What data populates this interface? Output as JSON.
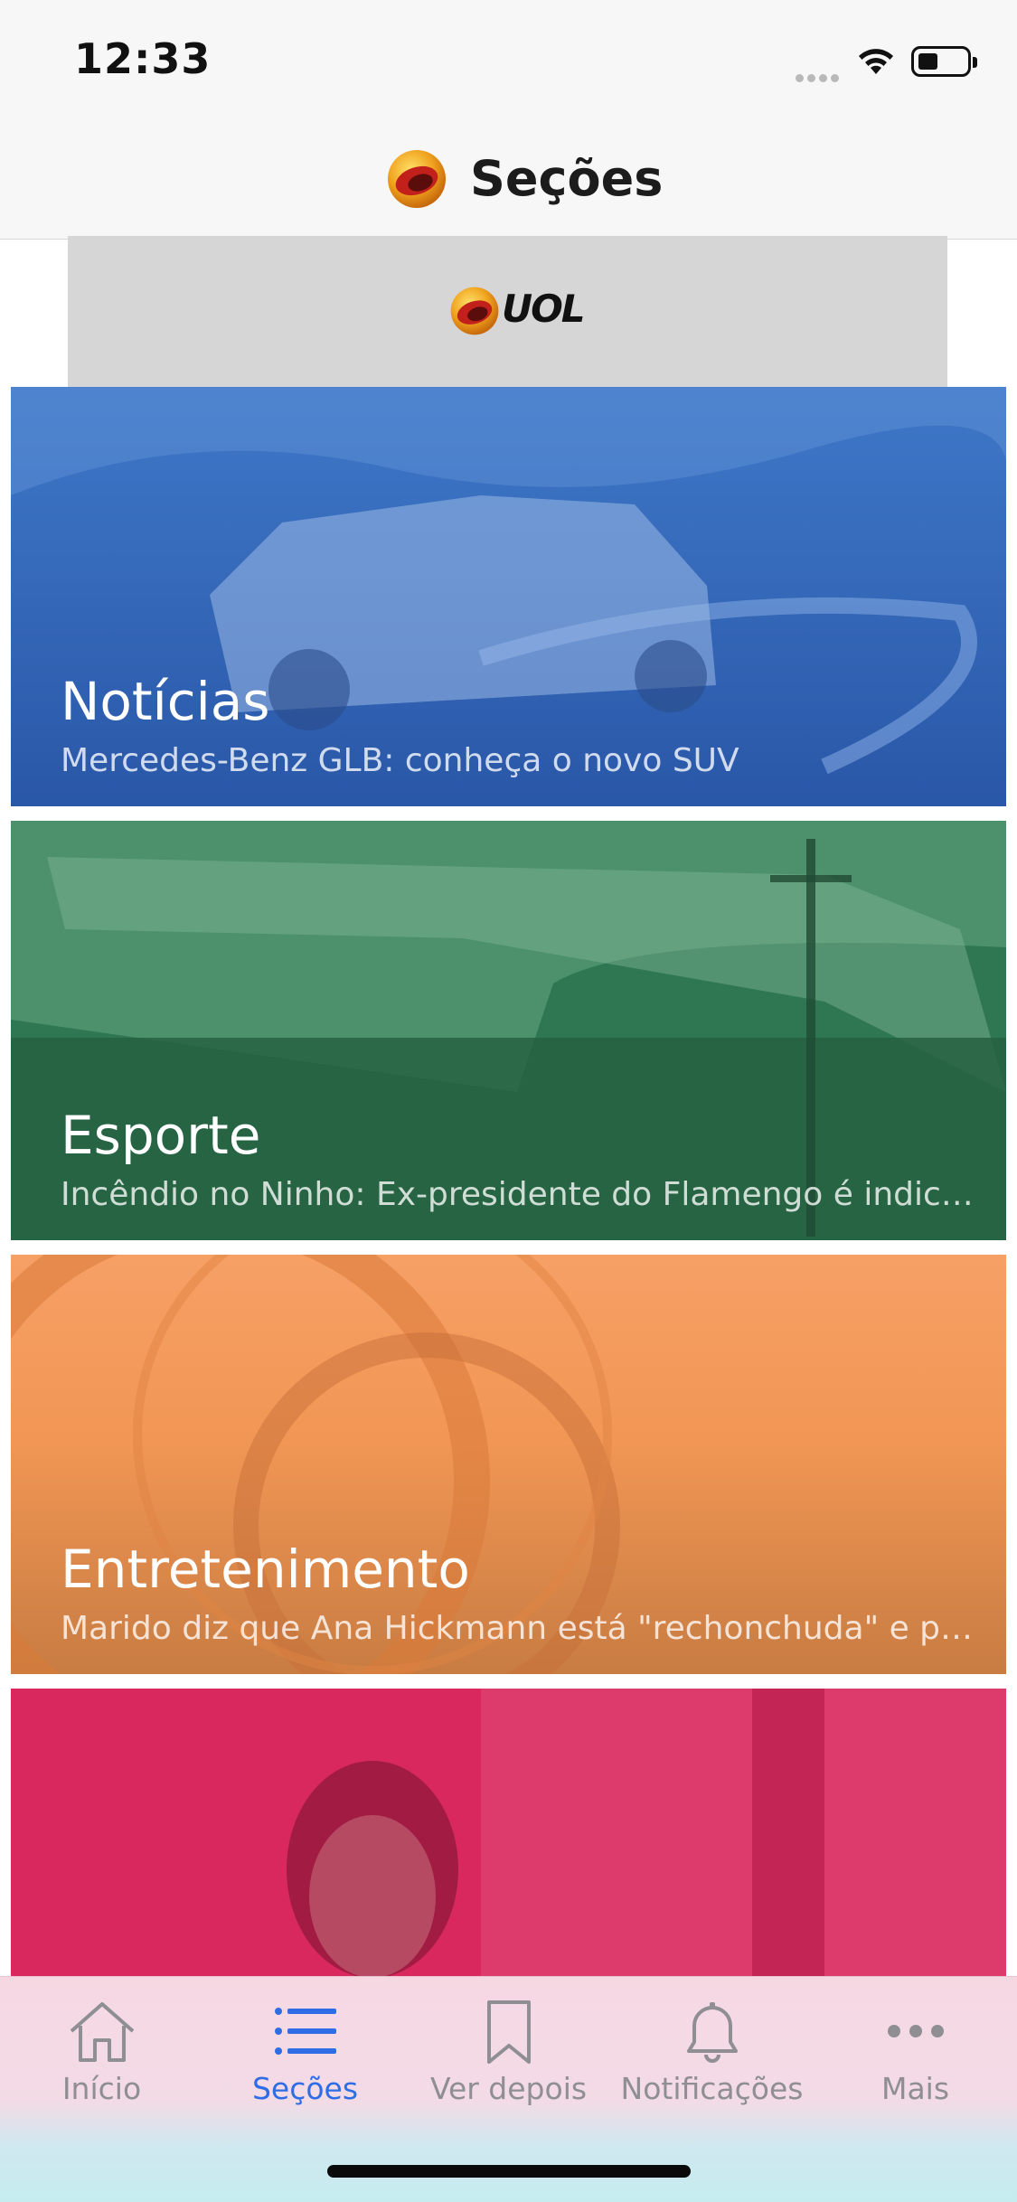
{
  "status_bar": {
    "time": "12:33"
  },
  "nav": {
    "title": "Seções"
  },
  "ad_banner": {
    "logo_text": "UOL"
  },
  "sections": [
    {
      "title": "Notícias",
      "subtitle": "Mercedes-Benz GLB: conheça o novo SUV",
      "color": "#2f5fb0"
    },
    {
      "title": "Esporte",
      "subtitle": "Incêndio no Ninho: Ex-presidente do Flamengo é indiciado",
      "color": "#2f7a55"
    },
    {
      "title": "Entretenimento",
      "subtitle": "Marido diz que Ana Hickmann está \"rechonchuda\" e pede",
      "color": "#e48a4c"
    },
    {
      "title": "",
      "subtitle": "",
      "color": "#d8245c"
    }
  ],
  "tab_bar": {
    "items": [
      {
        "label": "Início",
        "icon": "home-icon",
        "active": false
      },
      {
        "label": "Seções",
        "icon": "list-icon",
        "active": true
      },
      {
        "label": "Ver depois",
        "icon": "bookmark-icon",
        "active": false
      },
      {
        "label": "Notificações",
        "icon": "bell-icon",
        "active": false
      },
      {
        "label": "Mais",
        "icon": "more-icon",
        "active": false
      }
    ],
    "active_color": "#2f6de6",
    "inactive_color": "#8e8e93"
  }
}
